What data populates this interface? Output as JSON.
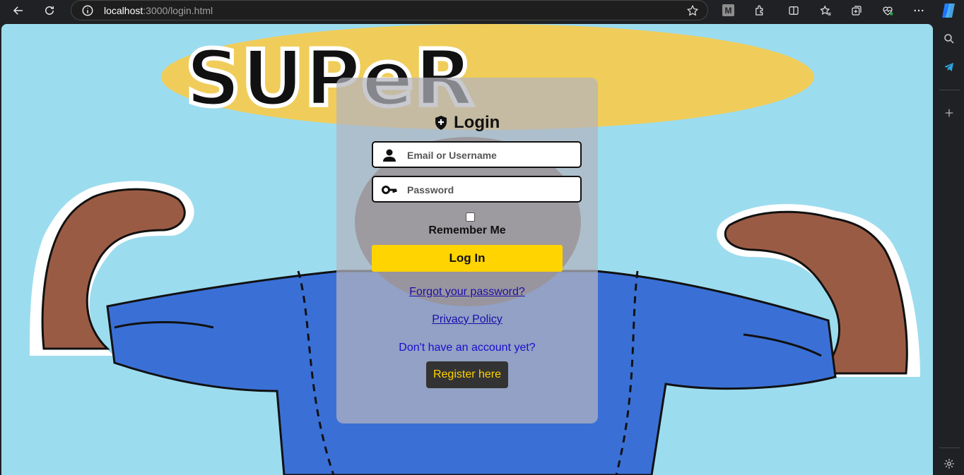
{
  "browser": {
    "url_host": "localhost",
    "url_path": ":3000/login.html",
    "ext_badge": "M"
  },
  "page": {
    "banner_text": "SUPeR"
  },
  "login": {
    "title": "Login",
    "username_placeholder": "Email or Username",
    "password_placeholder": "Password",
    "remember_label": "Remember Me",
    "login_button": "Log In",
    "forgot_link": "Forgot your password?",
    "privacy_link": "Privacy Policy",
    "no_account_text": "Don't have an account yet?",
    "register_button": "Register here"
  },
  "colors": {
    "accent_yellow": "#ffd400",
    "link_blue": "#1a0dab",
    "background_sky": "#9cdcef",
    "scrubs_blue": "#3a70d6"
  }
}
